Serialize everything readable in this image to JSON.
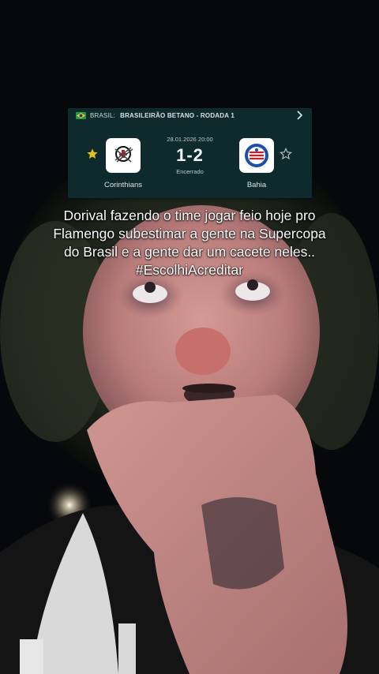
{
  "match_card": {
    "country": "BRASIL:",
    "competition": "BRASILEIRÃO BETANO - RODADA 1",
    "date": "28.01.2026 20:00",
    "score": "1-2",
    "status": "Encerrado",
    "home_team": "Corinthians",
    "away_team": "Bahia",
    "colors": {
      "card_bg": "#0f2a2c",
      "favorite_star": "#e4c21c"
    }
  },
  "caption": {
    "lines": [
      "Dorival fazendo o time jogar feio hoje pro",
      "Flamengo subestimar a gente na Supercopa",
      "do Brasil e a gente dar um cacete neles..",
      "#EscolhiAcreditar"
    ]
  }
}
